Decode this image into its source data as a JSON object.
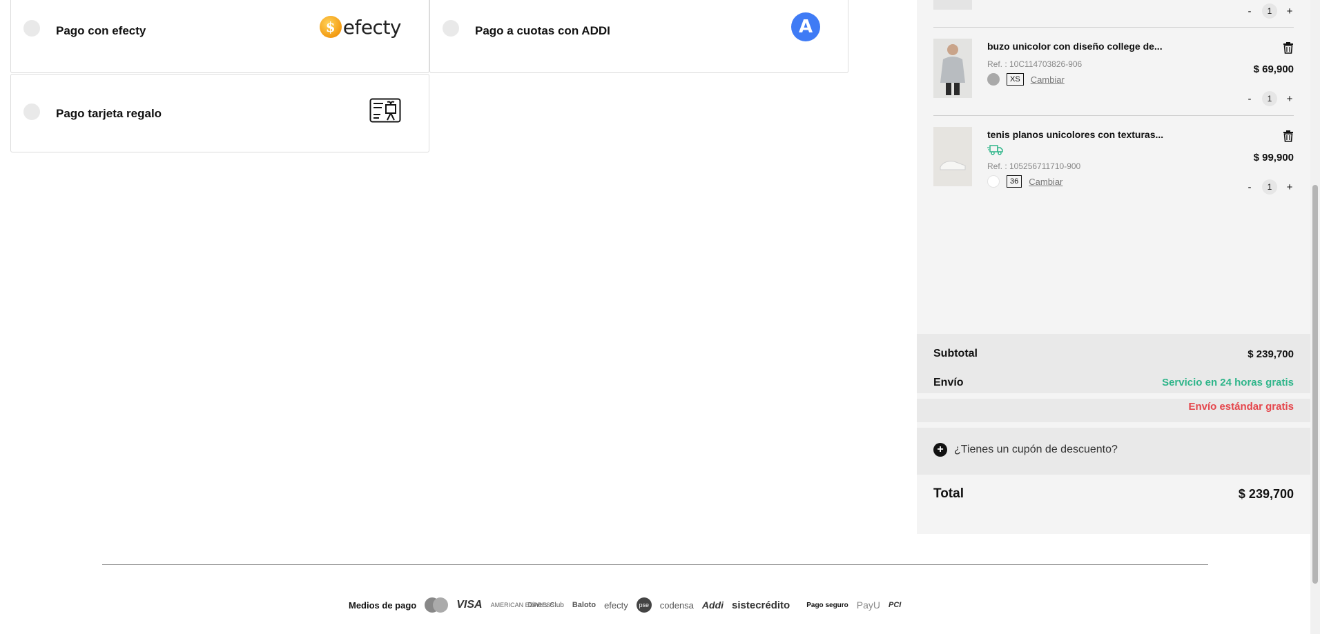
{
  "payment_options": [
    {
      "label": "Pago con efecty",
      "logo_text": "efecty",
      "logo_mark": "$"
    },
    {
      "label": "Pago a cuotas con ADDI",
      "logo_mark": "A"
    },
    {
      "label": "Pago tarjeta regalo",
      "icon": "gift-card-icon"
    }
  ],
  "cart": {
    "top_item": {
      "quantity": "1"
    },
    "items": [
      {
        "name": "buzo unicolor con diseño college de...",
        "ref": "Ref. : 10C114703826-906",
        "size": "XS",
        "change_label": "Cambiar",
        "price": "$ 69,900",
        "quantity": "1",
        "swatch_color": "#a9a9a9"
      },
      {
        "name": "tenis planos unicolores con texturas...",
        "ref": "Ref. : 105256711710-900",
        "size": "36",
        "change_label": "Cambiar",
        "price": "$ 99,900",
        "quantity": "1",
        "swatch_color": "#ffffff",
        "shipping_badge_icon": "delivery-truck-icon"
      }
    ],
    "summary": {
      "subtotal_label": "Subtotal",
      "subtotal_value": "$ 239,700",
      "shipping_label": "Envío",
      "shipping_fast": "Servicio en 24 horas gratis",
      "shipping_standard": "Envío estándar gratis",
      "coupon_text": "¿Tienes un cupón de descuento?",
      "total_label": "Total",
      "total_value": "$ 239,700"
    },
    "qty_minus": "-",
    "qty_plus": "+"
  },
  "footer": {
    "payment_methods_label": "Medios de pago",
    "visa": "VISA",
    "amex": "AMERICAN EXPRESS",
    "diners": "Diners Club",
    "baloto": "Baloto",
    "efecty": "efecty",
    "pse": "pse",
    "codensa": "codensa",
    "addi": "Addi",
    "sistecredito": "sistecrédito",
    "secure_label": "Pago seguro",
    "payu": "PayU",
    "pci": "PCI"
  },
  "colors": {
    "green": "#2fb58a",
    "red": "#e5454b",
    "addi_blue": "#3f7bf5",
    "panel_bg": "#f4f4f4"
  }
}
